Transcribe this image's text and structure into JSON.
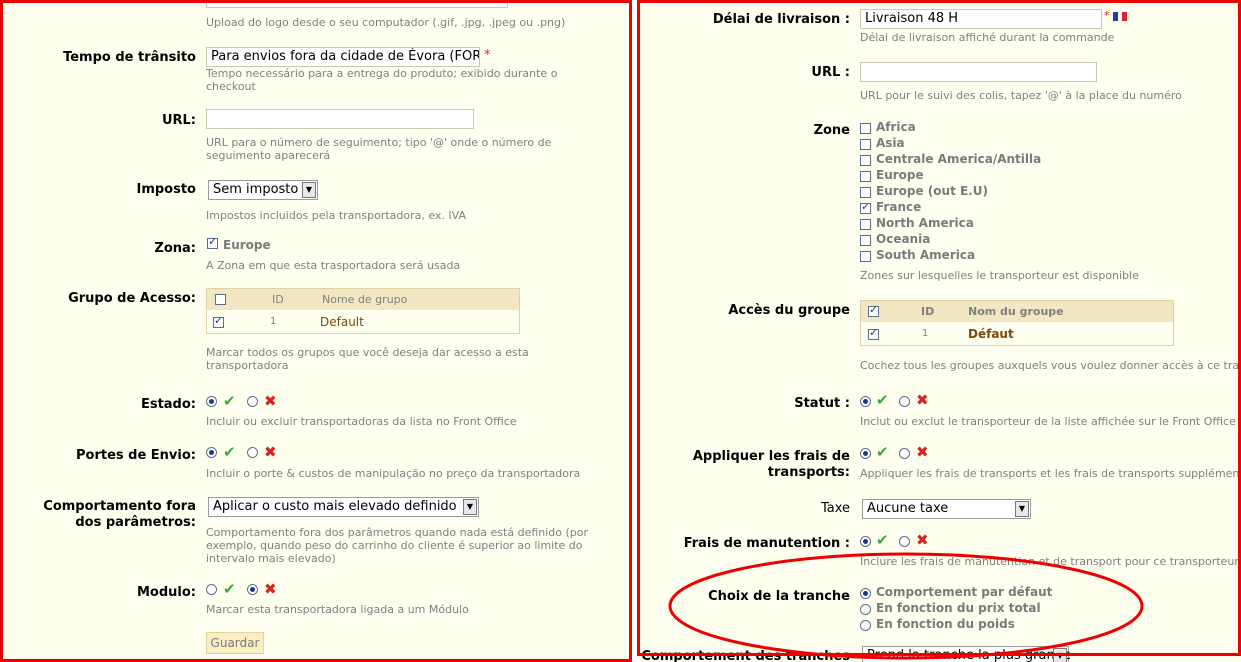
{
  "left": {
    "logo_help": "Upload do logo desde o seu computador (.gif, .jpg, .jpeg ou .png)",
    "transit": {
      "label": "Tempo de trânsito",
      "value": "Para envios fora da cidade de Évora (FOR/",
      "required": "*",
      "help": "Tempo necessário para a entrega do produto; exibido durante o checkout"
    },
    "url": {
      "label": "URL:",
      "value": "",
      "help": "URL para o número de seguimento; tipo '@' onde o número de seguimento aparecerá"
    },
    "tax": {
      "label": "Imposto",
      "selected": "Sem imposto",
      "help": "Impostos incluidos pela transportadora, ex. IVA"
    },
    "zone": {
      "label": "Zona:",
      "item": "Europe",
      "help": "A Zona em que esta trasportadora será usada"
    },
    "group": {
      "label": "Grupo de Acesso:",
      "col_id": "ID",
      "col_name": "Nome de grupo",
      "row_id": "1",
      "row_name": "Default",
      "help": "Marcar todos os grupos que você deseja dar acesso a esta transportadora"
    },
    "state": {
      "label": "Estado:",
      "help": "Incluir ou excluir transportadoras da lista no Front Office"
    },
    "shipping": {
      "label": "Portes de Envio:",
      "help": "Incluir o porte & custos de manipulação no preço da transportadora"
    },
    "behavior": {
      "label_line1": "Comportamento fora",
      "label_line2": "dos parâmetros:",
      "selected": "Aplicar o custo mais elevado definido",
      "help": "Comportamento fora dos parâmetros quando nada está definido (por exemplo, quando peso do carrinho do cliente é superior ao limite do intervalo mais elevado)"
    },
    "module": {
      "label": "Modulo:",
      "help": "Marcar esta transportadora ligada a um Módulo"
    },
    "save_label": "Guardar"
  },
  "right": {
    "delay": {
      "label": "Délai de livraison :",
      "value": "Livraison 48 H",
      "required": "*",
      "help": "Délai de livraison affiché durant la commande"
    },
    "url": {
      "label": "URL :",
      "value": "",
      "help": "URL pour le suivi des colis, tapez '@' à la place du numéro"
    },
    "zone": {
      "label": "Zone",
      "items": [
        {
          "name": "Africa",
          "checked": false
        },
        {
          "name": "Asia",
          "checked": false
        },
        {
          "name": "Centrale America/Antilla",
          "checked": false
        },
        {
          "name": "Europe",
          "checked": false
        },
        {
          "name": "Europe (out E.U)",
          "checked": false
        },
        {
          "name": "France",
          "checked": true
        },
        {
          "name": "North America",
          "checked": false
        },
        {
          "name": "Oceania",
          "checked": false
        },
        {
          "name": "South America",
          "checked": false
        }
      ],
      "help": "Zones sur lesquelles le transporteur est disponible"
    },
    "group": {
      "label": "Accès du groupe",
      "col_id": "ID",
      "col_name": "Nom du groupe",
      "row_id": "1",
      "row_name": "Défaut",
      "help": "Cochez tous les groupes auxquels vous voulez donner accès à ce transporte"
    },
    "status": {
      "label": "Statut :",
      "help": "Inclut ou exclut le transporteur de la liste affichée sur le Front Office"
    },
    "fees": {
      "label_line1": "Appliquer les frais de",
      "label_line2": "transports:",
      "help": "Appliquer les frais de transports et les frais de transports supplémentaires par"
    },
    "tax": {
      "label": "Taxe",
      "selected": "Aucune taxe"
    },
    "handling": {
      "label": "Frais de manutention :",
      "help": "Inclure les frais de manutention et de transport pour ce transporteur"
    },
    "range": {
      "label": "Choix de la tranche",
      "options": [
        "Comportement par défaut",
        "En fonction du prix total",
        "En fonction du poids"
      ]
    },
    "range_behavior": {
      "label": "Comportement des tranches :",
      "selected": "Prend la tranche la plus grande"
    }
  },
  "colors": {
    "frame": "#ee0000",
    "panel_bg": "#fffff0",
    "help_text": "#7f7f7f",
    "check_green": "#3ea83a",
    "cross_red": "#e02020"
  }
}
